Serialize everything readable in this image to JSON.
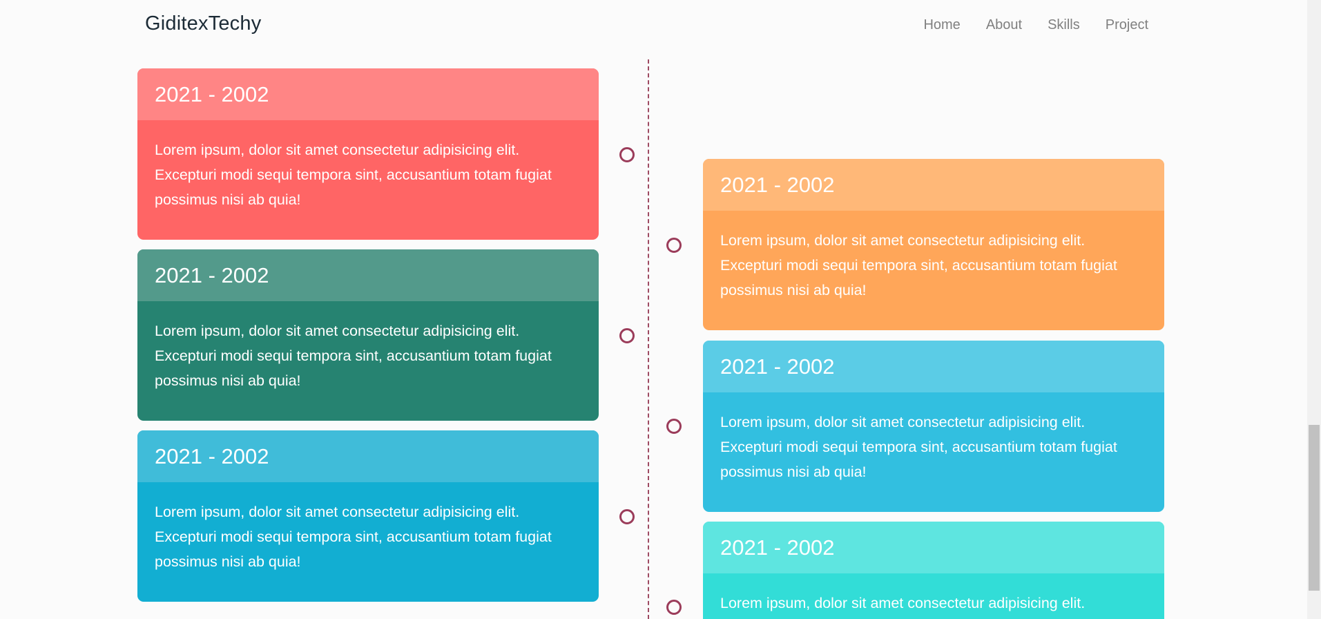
{
  "navbar": {
    "brand": "GiditexTechy",
    "links": [
      "Home",
      "About",
      "Skills",
      "Project"
    ]
  },
  "colors": {
    "timeline_line": "#9e4a62",
    "timeline_dot": "#9b3c5a"
  },
  "timeline": {
    "left_cards": [
      {
        "year": "2021 - 2002",
        "text": "Lorem ipsum, dolor sit amet consectetur adipisicing elit. Excepturi modi sequi tempora sint, accusantium totam fugiat possimus nisi ab quia!",
        "header_color": "#ff8585",
        "body_color": "#ff6565"
      },
      {
        "year": "2021 - 2002",
        "text": "Lorem ipsum, dolor sit amet consectetur adipisicing elit. Excepturi modi sequi tempora sint, accusantium totam fugiat possimus nisi ab quia!",
        "header_color": "#539a8b",
        "body_color": "#268371"
      },
      {
        "year": "2021 - 2002",
        "text": "Lorem ipsum, dolor sit amet consectetur adipisicing elit. Excepturi modi sequi tempora sint, accusantium totam fugiat possimus nisi ab quia!",
        "header_color": "#40bcd9",
        "body_color": "#12aed2"
      }
    ],
    "right_cards": [
      {
        "year": "2021 - 2002",
        "text": "Lorem ipsum, dolor sit amet consectetur adipisicing elit. Excepturi modi sequi tempora sint, accusantium totam fugiat possimus nisi ab quia!",
        "header_color": "#ffb878",
        "body_color": "#ffa659"
      },
      {
        "year": "2021 - 2002",
        "text": "Lorem ipsum, dolor sit amet consectetur adipisicing elit. Excepturi modi sequi tempora sint, accusantium totam fugiat possimus nisi ab quia!",
        "header_color": "#5bcce6",
        "body_color": "#32bfe0"
      },
      {
        "year": "2021 - 2002",
        "text": "Lorem ipsum, dolor sit amet consectetur adipisicing elit.",
        "header_color": "#5ee5e0",
        "body_color": "#32ddd7"
      }
    ]
  }
}
